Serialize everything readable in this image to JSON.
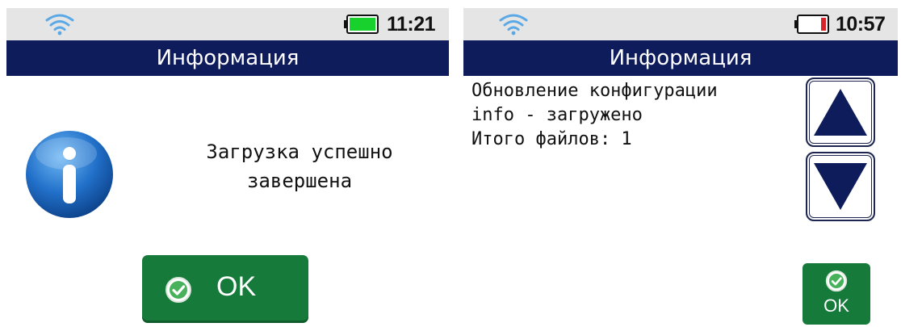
{
  "left_screen": {
    "status": {
      "time": "11:21",
      "battery_color": "#19d12c",
      "wifi_icon": "wifi-icon"
    },
    "title": "Информация",
    "message": [
      "Загрузка успешно",
      "завершена"
    ],
    "ok_button": {
      "label": "OK",
      "icon": "check-circle-icon"
    }
  },
  "right_screen": {
    "status": {
      "time": "10:57",
      "battery_color": "#d8232a",
      "wifi_icon": "wifi-icon"
    },
    "title": "Информация",
    "log_lines": [
      "Обновление конфигурации",
      "info - загружено",
      "Итого файлов: 1"
    ],
    "scroll_up_icon": "triangle-up-icon",
    "scroll_down_icon": "triangle-down-icon",
    "ok_button": {
      "label": "OK",
      "icon": "check-circle-icon"
    }
  },
  "colors": {
    "title_bar": "#0e1c5c",
    "ok_green": "#157a3a",
    "status_bar": "#e5e5e5"
  }
}
